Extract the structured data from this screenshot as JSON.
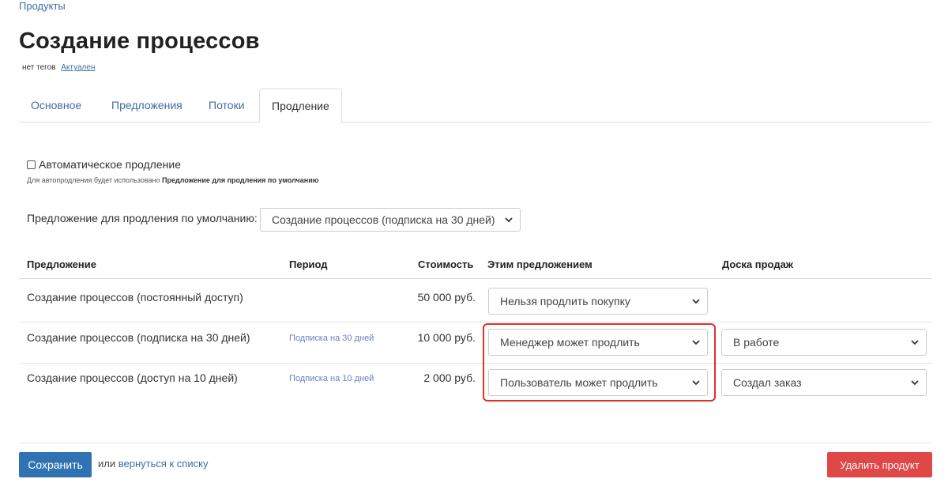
{
  "breadcrumb": "Продукты",
  "page_title": "Создание процессов",
  "tags_text": "нет тегов",
  "status_link": "Актуален",
  "tabs": [
    {
      "label": "Основное"
    },
    {
      "label": "Предложения"
    },
    {
      "label": "Потоки"
    },
    {
      "label": "Продление",
      "active": true
    }
  ],
  "auto_renew": {
    "label": "Автоматическое продление",
    "checked": false,
    "hint_prefix": "Для автопродления будет использовано",
    "hint_bold": "Предложение для продления по умолчанию"
  },
  "default_offer": {
    "label": "Предложение для продления по умолчанию:",
    "value": "Создание процессов (подписка на 30 дней)"
  },
  "table": {
    "headers": {
      "offer": "Предложение",
      "period": "Период",
      "price": "Стоимость",
      "renewal": "Этим предложением",
      "board": "Доска продаж"
    },
    "rows": [
      {
        "offer": "Создание процессов (постоянный доступ)",
        "period": "",
        "price": "50 000 руб.",
        "renewal": "Нельзя продлить покупку",
        "board": ""
      },
      {
        "offer": "Создание процессов (подписка на 30 дней)",
        "period": "Подписка на 30 дней",
        "price": "10 000 руб.",
        "renewal": "Менеджер может продлить",
        "board": "В работе"
      },
      {
        "offer": "Создание процессов (доступ на 10 дней)",
        "period": "Подписка на 10 дней",
        "price": "2 000 руб.",
        "renewal": "Пользователь может продлить",
        "board": "Создал заказ"
      }
    ]
  },
  "footer": {
    "save_label": "Сохранить",
    "or_text": "или",
    "back_label": "вернуться к списку",
    "delete_label": "Удалить продукт"
  },
  "colors": {
    "link": "#3b6ea5",
    "primary_button": "#2f73b3",
    "danger_button": "#e04848",
    "highlight_border": "#e0312a"
  }
}
